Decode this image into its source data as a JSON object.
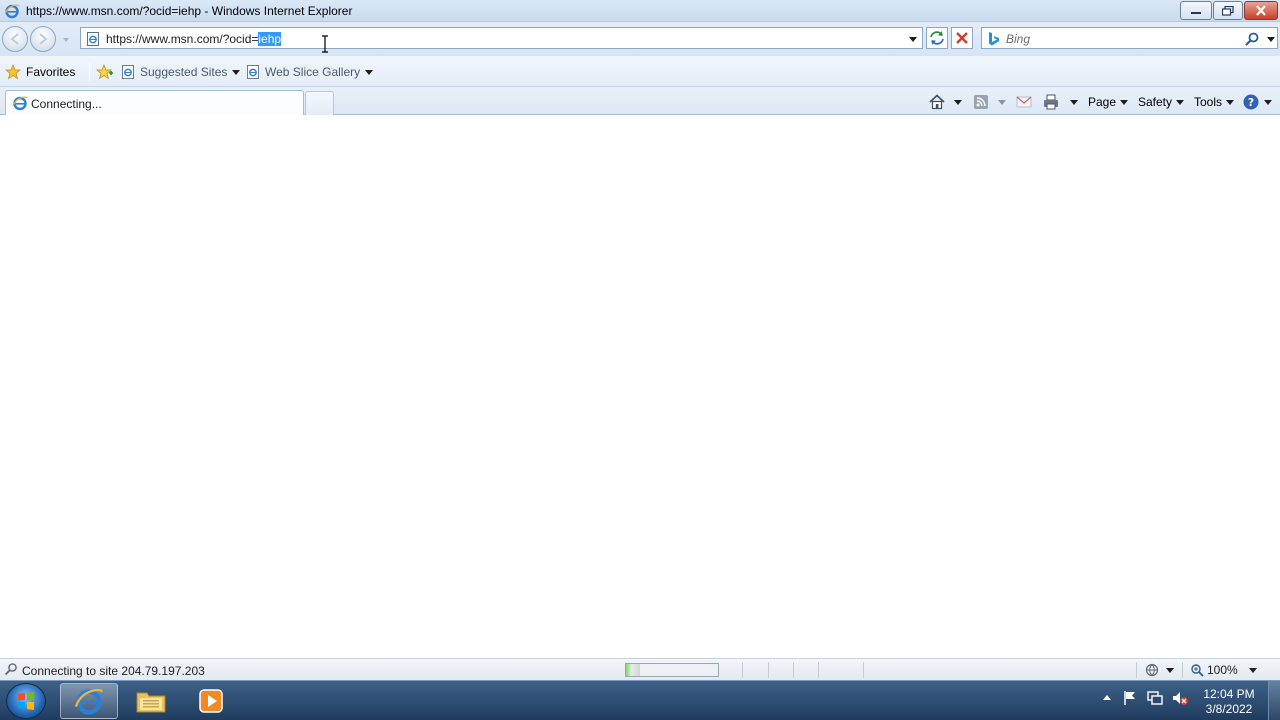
{
  "window": {
    "title": "https://www.msn.com/?ocid=iehp - Windows Internet Explorer"
  },
  "address_bar": {
    "url_prefix": "https://www.msn.com/?ocid=",
    "url_selected": "iehp"
  },
  "search": {
    "placeholder": "Bing"
  },
  "favorites_bar": {
    "favorites_label": "Favorites",
    "items": [
      {
        "label": "Suggested Sites"
      },
      {
        "label": "Web Slice Gallery"
      }
    ]
  },
  "tab": {
    "label": "Connecting..."
  },
  "command_bar": {
    "page_label": "Page",
    "safety_label": "Safety",
    "tools_label": "Tools"
  },
  "status_bar": {
    "message": "Connecting to site 204.79.197.203",
    "progress": 0.15,
    "zoom": "100%"
  },
  "taskbar": {
    "time": "12:04 PM",
    "date": "3/8/2022"
  },
  "colors": {
    "selection": "#3399ff",
    "taskbar": "#2a4a70"
  }
}
